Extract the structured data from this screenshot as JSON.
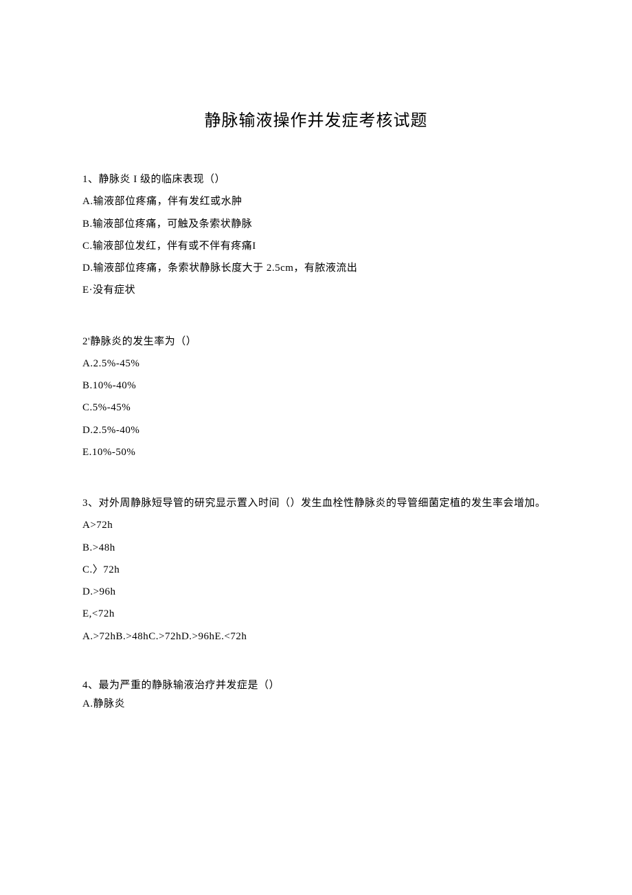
{
  "title": "静脉输液操作并发症考核试题",
  "questions": [
    {
      "number": "1、",
      "text": "静脉炎 I 级的临床表现（）",
      "options": [
        "A.输液部位疼痛，伴有发红或水肿",
        "B.输液部位疼痛，可触及条索状静脉",
        "C.输液部位发红，伴有或不伴有疼痛I",
        "D.输液部位疼痛，条索状静脉长度大于 2.5cm，有脓液流出",
        "E·没有症状"
      ]
    },
    {
      "number": "2'",
      "text": "静脉炎的发生率为（）",
      "options": [
        "A.2.5%-45%",
        "B.10%-40%",
        "C.5%-45%",
        "D.2.5%-40%",
        "E.10%-50%"
      ]
    },
    {
      "number": "3、",
      "text": "对外周静脉短导管的研究显示置入时间（）发生血栓性静脉炎的导管细菌定植的发生率会增加。",
      "options": [
        "A>72h",
        "B.>48h",
        "C.〉72h",
        "D.>96h",
        "E,<72h",
        "A.>72hB.>48hC.>72hD.>96hE.<72h"
      ]
    },
    {
      "number": "4、",
      "text": "最为严重的静脉输液治疗并发症是（）",
      "options": [
        "A.静脉炎"
      ]
    }
  ]
}
